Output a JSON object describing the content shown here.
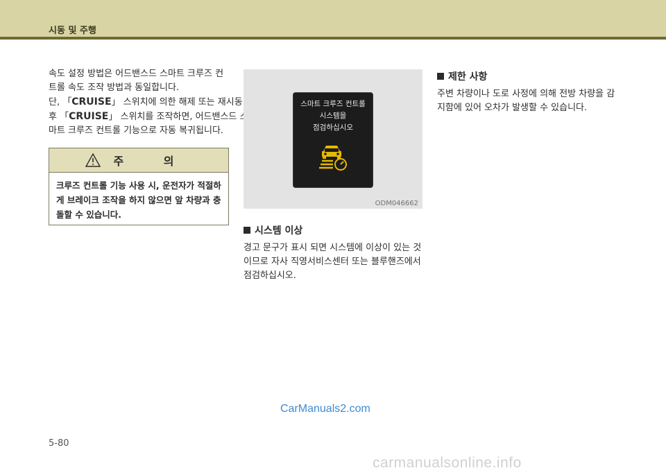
{
  "header": {
    "section_title": "시동 및 주행"
  },
  "col1": {
    "lines": [
      "속도 설정 방법은 어드밴스드 스마트 크루즈 컨",
      "트롤 속도 조작 방법과 동일합니다.",
      "단, 「",
      "」 스위치에 의한 해제 또는 재시동",
      "후 「",
      "」 스위치를 조작하면, 어드밴스드 스",
      "마트 크루즈 컨트롤 기능으로 자동 복귀됩니다."
    ],
    "button_name": "CRUISE"
  },
  "caution": {
    "title": "주 의",
    "lines": [
      "크루즈 컨트롤 기능 사용 시, 운전자가 적절하",
      "게 브레이크 조작을 하지 않으면 앞 차량과 충",
      "돌할 수 있습니다."
    ]
  },
  "figure": {
    "display_lines": [
      "스마트 크루즈 컨트롤",
      "시스템을",
      "점검하십시오"
    ],
    "code": "ODM046662"
  },
  "system_error": {
    "heading": "시스템 이상",
    "lines": [
      "경고 문구가 표시 되면 시스템에 이상이 있는 것",
      "이므로 자사 직영서비스센터 또는 블루핸즈에서",
      "점검하십시오."
    ]
  },
  "limitations": {
    "heading": "제한 사항",
    "lines": [
      "주변 차량이나 도로 사정에 의해 전방 차량을 감",
      "지함에 있어 오차가 발생할 수 있습니다."
    ]
  },
  "watermark": "CarManuals2.com",
  "page_number": "5-80",
  "footer_watermark": "carmanualsonline.info",
  "colors": {
    "header_band": "#d8d4a4",
    "header_line": "#6e6a34",
    "cluster_icon": "#e6b800"
  }
}
